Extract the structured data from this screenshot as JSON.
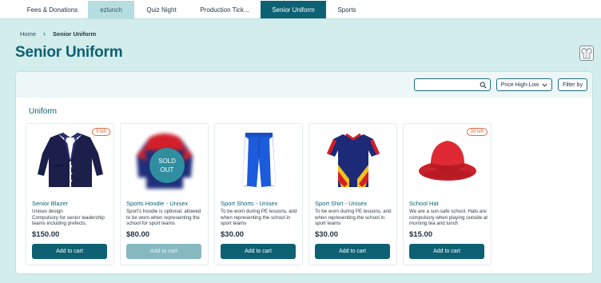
{
  "tabs": [
    {
      "label": "Fees & Donations",
      "state": "normal"
    },
    {
      "label": "ezlunch",
      "state": "muted"
    },
    {
      "label": "Quiz Night",
      "state": "normal"
    },
    {
      "label": "Production Tick...",
      "state": "normal"
    },
    {
      "label": "Senior Uniform",
      "state": "active"
    },
    {
      "label": "Sports",
      "state": "normal"
    }
  ],
  "breadcrumb": {
    "home": "Home",
    "separator": "›",
    "current": "Senior Uniform"
  },
  "page": {
    "title": "Senior Uniform"
  },
  "toolbar": {
    "search_value": "",
    "sort_label": "Price High-Low",
    "filter_label": "Filter by"
  },
  "section": {
    "title": "Uniform"
  },
  "products": [
    {
      "name": "Senior Blazer",
      "description": "Unisex design\nCompulsory for senior leadership teams including prefects,",
      "price": "$150.00",
      "stock_badge": "9 left",
      "button_label": "Add to cart",
      "sold_out": false
    },
    {
      "name": "Sports Hoodie - Unisex",
      "description": "Sport's hoodie is optional, allowed to be worn when representing the school for sport teams",
      "price": "$80.00",
      "stock_badge": "",
      "sold_out_label_1": "SOLD",
      "sold_out_label_2": "OUT",
      "button_label": "Add to cart",
      "sold_out": true
    },
    {
      "name": "Sport Shorts - Unisex",
      "description": "To be worn during PE lessons, and when representing the school in sport teams",
      "price": "$30.00",
      "stock_badge": "",
      "button_label": "Add to cart",
      "sold_out": false
    },
    {
      "name": "Sport Shirt - Unisex",
      "description": "To be worn during PE lessons, and when representing the school in sport teams",
      "price": "$30.00",
      "stock_badge": "",
      "button_label": "Add to cart",
      "sold_out": false
    },
    {
      "name": "School Hat",
      "description": "We are a sun-safe school.  Hats are compulsory when playing outside at morning tea and lunch",
      "price": "$15.00",
      "stock_badge": "39 left",
      "button_label": "Add to cart",
      "sold_out": false
    }
  ],
  "colors": {
    "brand": "#0d6173",
    "background": "#d3ecec",
    "badge": "#e06a4a",
    "sold_out": "#2f8ea0"
  },
  "icons": [
    "search-icon",
    "chevron-down-icon",
    "uniform-shirt-icon"
  ]
}
